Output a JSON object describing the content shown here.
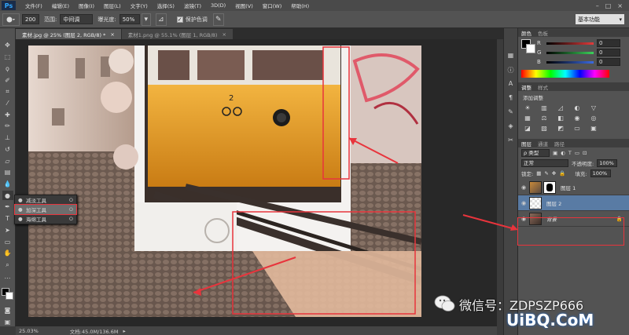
{
  "menubar": {
    "logo": "Ps",
    "items": [
      "文件(F)",
      "编辑(E)",
      "图像(I)",
      "图层(L)",
      "文字(Y)",
      "选择(S)",
      "滤镜(T)",
      "3D(D)",
      "视图(V)",
      "窗口(W)",
      "帮助(H)"
    ],
    "window_controls": [
      "–",
      "□",
      "×"
    ]
  },
  "options": {
    "brush_size": "200",
    "range_label": "范围:",
    "range_value": "中间调",
    "exposure_label": "曝光度:",
    "exposure_value": "50%",
    "protect_label": "保护色调",
    "protect_checked": "✓",
    "workspace": "基本功能"
  },
  "tabs": [
    {
      "label": "素材.jpg @ 25% (图层 2, RGB/8) *",
      "close": "×"
    },
    {
      "label": "素材1.png @ 55.1% (图层 1, RGB/8)",
      "close": "×"
    }
  ],
  "flyout": {
    "items": [
      {
        "icon": "●",
        "label": "减淡工具",
        "key": "O"
      },
      {
        "icon": "●",
        "label": "加深工具",
        "key": "O"
      },
      {
        "icon": "●",
        "label": "海绵工具",
        "key": "O"
      }
    ]
  },
  "status": {
    "zoom": "25.03%",
    "doc_info": "文档:45.0M/136.6M"
  },
  "color_panel": {
    "tabs": [
      "颜色",
      "色板"
    ],
    "channels": [
      {
        "label": "R",
        "value": "0",
        "color": "#e23b3b"
      },
      {
        "label": "G",
        "value": "0",
        "color": "#3bd05a"
      },
      {
        "label": "B",
        "value": "0",
        "color": "#3b6ae2"
      }
    ]
  },
  "adjust_panel": {
    "tabs": [
      "调整",
      "样式"
    ],
    "title": "添加调整"
  },
  "layers_panel": {
    "tabs": [
      "图层",
      "通道",
      "路径"
    ],
    "filter": "ρ 类型",
    "blend_mode": "正常",
    "opacity_label": "不透明度:",
    "opacity_value": "100%",
    "lock_label": "锁定:",
    "fill_label": "填充:",
    "fill_value": "100%",
    "layers": [
      {
        "name": "图层 1",
        "selected": false
      },
      {
        "name": "图层 2",
        "selected": true
      },
      {
        "name": "背景",
        "selected": false
      }
    ]
  },
  "watermark": {
    "text": "微信号：ZDPSZP666",
    "brand": "UiBQ.CoM"
  },
  "photo": {
    "tram_number": "2"
  },
  "accent_colors": {
    "annotation_red": "#e8343c",
    "layer_selected": "#597ba4"
  }
}
